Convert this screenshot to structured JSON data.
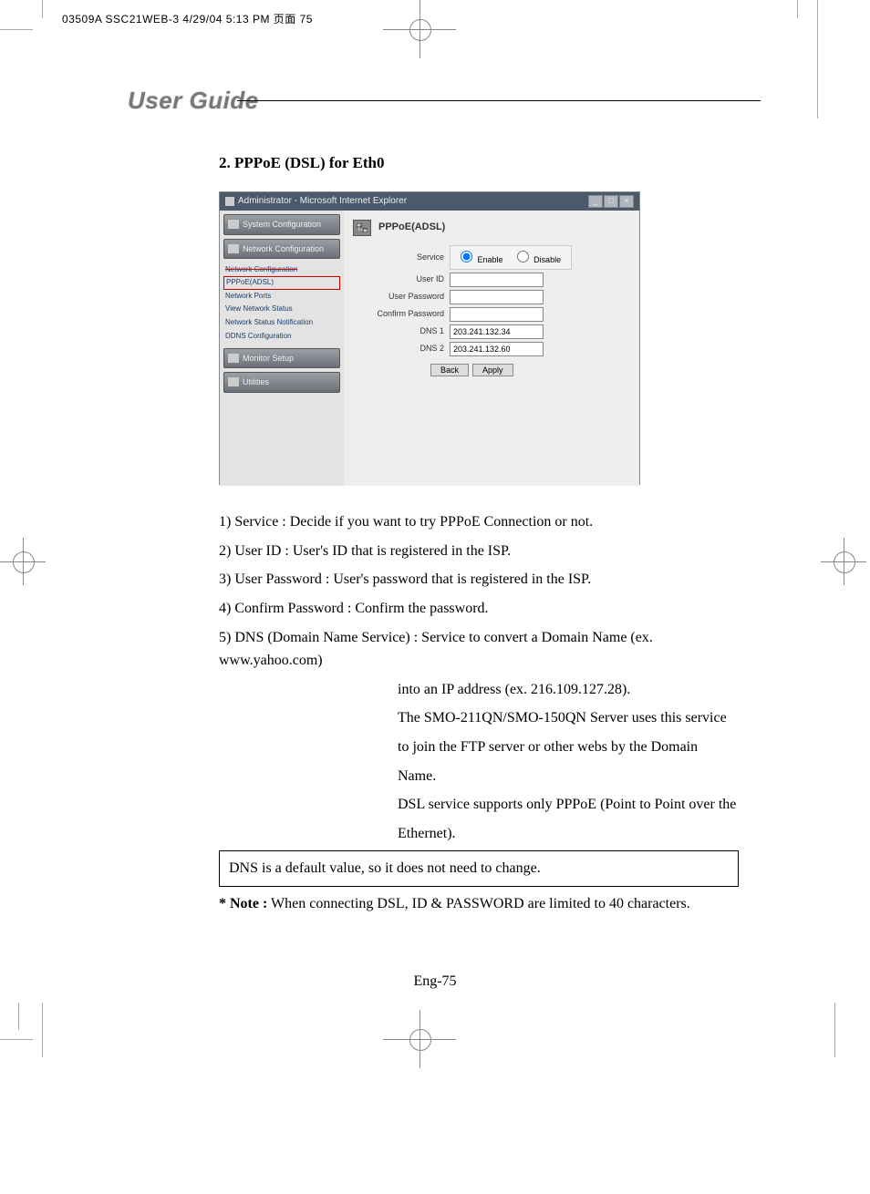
{
  "header_line": "03509A SSC21WEB-3  4/29/04  5:13 PM  页面 75",
  "section_title": "User Guide",
  "heading": "2. PPPoE (DSL) for Eth0",
  "screenshot": {
    "window_title": "Administrator - Microsoft Internet Explorer",
    "win_min": "_",
    "win_max": "□",
    "win_close": "×",
    "side": {
      "system": "System Configuration",
      "network": "Network Configuration",
      "items": {
        "a": "Network Configuration",
        "b": "PPPoE(ADSL)",
        "c": "Network Ports",
        "d": "View Network Status",
        "e": "Network Status Notification",
        "f": "DDNS Configuration"
      },
      "monitor": "Monitor Setup",
      "utilities": "Utilities"
    },
    "panel_title": "PPPoE(ADSL)",
    "form": {
      "service_label": "Service",
      "enable": "Enable",
      "disable": "Disable",
      "user_id_label": "User ID",
      "user_password_label": "User Password",
      "confirm_password_label": "Confirm Password",
      "dns1_label": "DNS 1",
      "dns1_value": "203.241.132.34",
      "dns2_label": "DNS 2",
      "dns2_value": "203.241.132.60",
      "back": "Back",
      "apply": "Apply"
    }
  },
  "explain": {
    "l1": "1) Service : Decide if you want to try PPPoE Connection or not.",
    "l2": "2) User ID : User's ID that is registered in the ISP.",
    "l3": "3) User Password : User's password that is registered in the ISP.",
    "l4": "4) Confirm Password : Confirm the password.",
    "l5": "5) DNS (Domain Name Service) : Service to convert a Domain Name (ex. www.yahoo.com)",
    "l5a": "into an IP address (ex. 216.109.127.28).",
    "l5b": "The SMO-211QN/SMO-150QN Server uses this service",
    "l5c": "to join the FTP server or other webs by the Domain",
    "l5d": "Name.",
    "l5e": "DSL service supports only PPPoE (Point to Point over the",
    "l5f": "Ethernet).",
    "box": "DNS is a default value, so it does not need to change."
  },
  "note_label": "* Note :",
  "note_text": " When connecting DSL, ID & PASSWORD are limited to 40 characters.",
  "page_num": "Eng-75"
}
